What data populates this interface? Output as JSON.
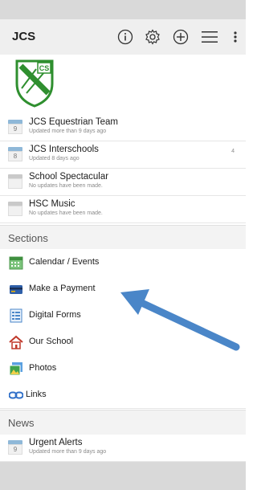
{
  "app": {
    "title": "JCS"
  },
  "feeds": [
    {
      "title": "JCS Equestrian Team",
      "subtitle": "Updated more than 9 days ago",
      "day": "9",
      "count": ""
    },
    {
      "title": "JCS Interschools",
      "subtitle": "Updated 8 days ago",
      "day": "8",
      "count": "4"
    },
    {
      "title": "School Spectacular",
      "subtitle": "No updates have been made.",
      "day": "",
      "count": ""
    },
    {
      "title": "HSC Music",
      "subtitle": "No updates have been made.",
      "day": "",
      "count": ""
    }
  ],
  "sections": {
    "header": "Sections",
    "items": [
      {
        "label": "Calendar / Events",
        "icon": "calendar-icon"
      },
      {
        "label": "Make a Payment",
        "icon": "payment-card-icon"
      },
      {
        "label": "Digital Forms",
        "icon": "forms-icon"
      },
      {
        "label": "Our School",
        "icon": "house-icon"
      },
      {
        "label": "Photos",
        "icon": "photos-icon"
      },
      {
        "label": "Links",
        "icon": "links-icon"
      }
    ]
  },
  "news": {
    "header": "News",
    "items": [
      {
        "title": "Urgent Alerts",
        "subtitle": "Updated more than 9 days ago",
        "day": "9"
      }
    ]
  },
  "logo": {
    "text": "CS"
  },
  "colors": {
    "logo_green": "#2f8f2f",
    "arrow_blue": "#4a86c8",
    "calendar_blue": "#8fb8d8"
  }
}
